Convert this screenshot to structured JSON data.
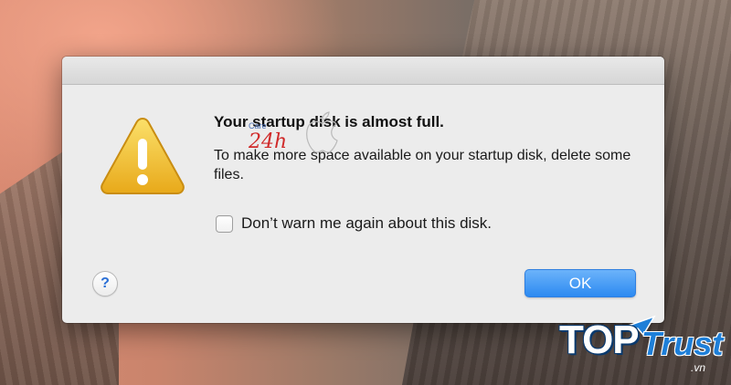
{
  "dialog": {
    "title": "Your startup disk is almost full.",
    "message": "To make more space available on your startup disk, delete some files.",
    "checkbox_label": "Don’t warn me again about this disk.",
    "checkbox_checked": false,
    "help_label": "?",
    "ok_label": "OK",
    "icon": "warning-icon"
  },
  "watermarks": {
    "care_text": "Care",
    "care_number": "24h",
    "brand_top": "TOP",
    "brand_trust": "Trust",
    "brand_vn": ".vn"
  },
  "colors": {
    "dialog_bg": "#ececec",
    "ok_button": "#2c8af1",
    "warning_yellow": "#f4c542",
    "help_blue": "#2a6fd6"
  }
}
